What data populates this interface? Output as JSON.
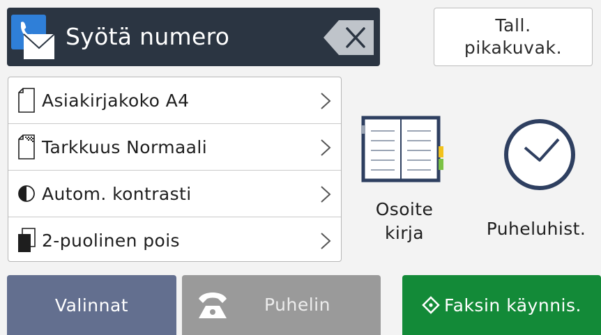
{
  "header": {
    "entry_label": "Syötä numero",
    "shortcut_line1": "Tall.",
    "shortcut_line2": "pikakuvak."
  },
  "settings": [
    {
      "label": "Asiakirjakoko A4",
      "icon": "document-icon"
    },
    {
      "label": "Tarkkuus Normaali",
      "icon": "resolution-document-icon"
    },
    {
      "label": "Autom. kontrasti",
      "icon": "contrast-icon"
    },
    {
      "label": "2-puolinen pois",
      "icon": "duplex-icon"
    }
  ],
  "tiles": {
    "address_book_line1": "Osoite",
    "address_book_line2": "kirja",
    "call_history": "Puheluhist."
  },
  "bottom": {
    "options": "Valinnat",
    "hook": "Puhelin",
    "start": "Faksin käynnis."
  },
  "colors": {
    "header_bg": "#2b3542",
    "options_bg": "#636f8f",
    "hook_bg": "#9a9a9a",
    "start_bg": "#138a38",
    "icon_blue": "#2e3f60"
  }
}
